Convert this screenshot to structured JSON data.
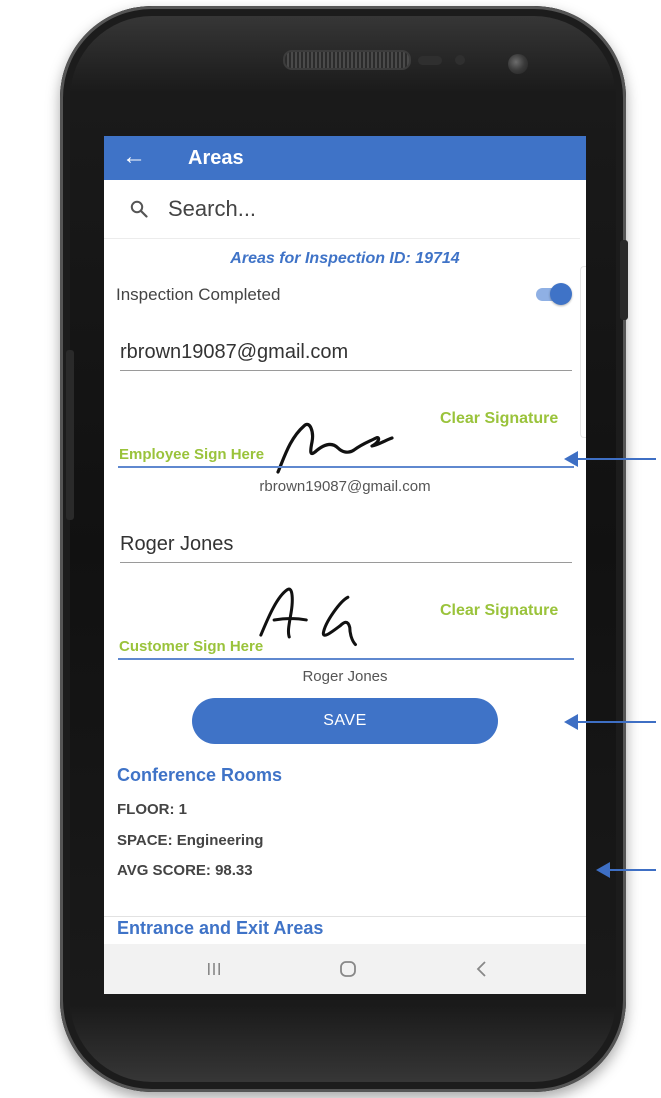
{
  "app": {
    "title": "Areas"
  },
  "search": {
    "placeholder": "Search..."
  },
  "inspection": {
    "heading": "Areas for Inspection ID: 19714",
    "completed_label": "Inspection Completed",
    "completed": true
  },
  "employee": {
    "email": "rbrown19087@gmail.com",
    "clear_label": "Clear Signature",
    "sign_label": "Employee Sign Here",
    "name_caption": "rbrown19087@gmail.com"
  },
  "customer": {
    "name": "Roger Jones",
    "clear_label": "Clear Signature",
    "sign_label": "Customer Sign Here",
    "name_caption": "Roger Jones"
  },
  "actions": {
    "save_label": "SAVE"
  },
  "areas": [
    {
      "title": "Conference Rooms",
      "floor": "FLOOR: 1",
      "space": "SPACE: Engineering",
      "avg_score": "AVG SCORE: 98.33"
    },
    {
      "title": "Entrance and Exit Areas"
    }
  ],
  "navbar": {
    "recents_icon": "recents-icon",
    "home_icon": "home-icon",
    "back_icon": "nav-back-icon"
  },
  "colors": {
    "primary": "#3f73c7",
    "signature_label": "#9ac33b",
    "annotation_arrow": "#3e6fc4"
  }
}
